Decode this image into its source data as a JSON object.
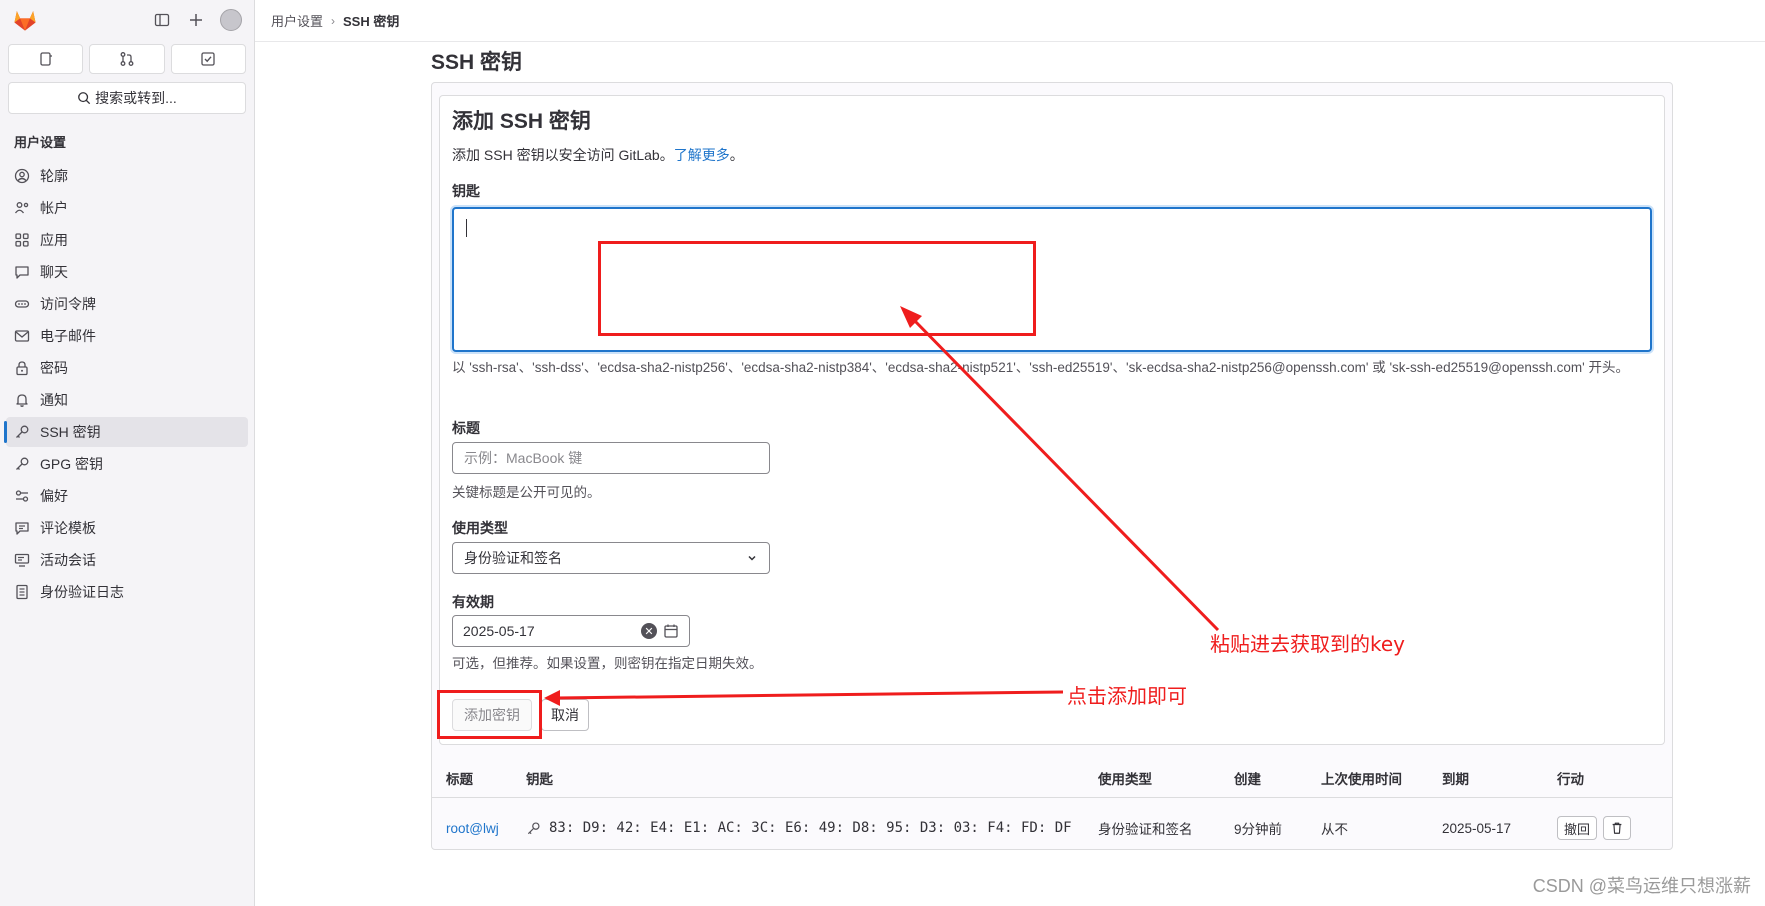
{
  "sidebar": {
    "search_label": "搜索或转到...",
    "section_title": "用户设置",
    "items": [
      {
        "label": "轮廓",
        "icon": "profile-icon"
      },
      {
        "label": "帐户",
        "icon": "account-icon"
      },
      {
        "label": "应用",
        "icon": "applications-icon"
      },
      {
        "label": "聊天",
        "icon": "chat-icon"
      },
      {
        "label": "访问令牌",
        "icon": "token-icon"
      },
      {
        "label": "电子邮件",
        "icon": "mail-icon"
      },
      {
        "label": "密码",
        "icon": "lock-icon"
      },
      {
        "label": "通知",
        "icon": "bell-icon"
      },
      {
        "label": "SSH 密钥",
        "icon": "key-icon",
        "active": true
      },
      {
        "label": "GPG 密钥",
        "icon": "key-icon"
      },
      {
        "label": "偏好",
        "icon": "preferences-icon"
      },
      {
        "label": "评论模板",
        "icon": "comment-icon"
      },
      {
        "label": "活动会话",
        "icon": "monitor-icon"
      },
      {
        "label": "身份验证日志",
        "icon": "log-icon"
      }
    ]
  },
  "breadcrumb": {
    "parent": "用户设置",
    "current": "SSH 密钥"
  },
  "page": {
    "title": "SSH 密钥"
  },
  "form": {
    "heading": "添加 SSH 密钥",
    "description": "添加 SSH 密钥以安全访问 GitLab。",
    "learn_more": "了解更多",
    "description_end": "。",
    "key_label": "钥匙",
    "key_value": "",
    "key_help": "以 'ssh-rsa'、'ssh-dss'、'ecdsa-sha2-nistp256'、'ecdsa-sha2-nistp384'、'ecdsa-sha2-nistp521'、'ssh-ed25519'、'sk-ecdsa-sha2-nistp256@openssh.com' 或 'sk-ssh-ed25519@openssh.com' 开头。",
    "title_label": "标题",
    "title_placeholder": "示例：MacBook 键",
    "title_help": "关键标题是公开可见的。",
    "usage_label": "使用类型",
    "usage_value": "身份验证和签名",
    "expire_label": "有效期",
    "expire_value": "2025-05-17",
    "expire_help": "可选，但推荐。如果设置，则密钥在指定日期失效。",
    "add_button": "添加密钥",
    "cancel_button": "取消"
  },
  "table": {
    "headers": [
      "标题",
      "钥匙",
      "使用类型",
      "创建",
      "上次使用时间",
      "到期",
      "行动"
    ],
    "rows": [
      {
        "title": "root@lwj",
        "fingerprint": "83: D9: 42: E4: E1: AC: 3C: E6: 49: D8: 95: D3: 03: F4: FD: DF",
        "usage": "身份验证和签名",
        "created": "9分钟前",
        "last_used": "从不",
        "expires": "2025-05-17",
        "revoke": "撤回"
      }
    ]
  },
  "annotations": {
    "paste_hint": "粘贴进去获取到的key",
    "click_hint": "点击添加即可"
  },
  "watermark": "CSDN @菜鸟运维只想涨薪",
  "colors": {
    "accent": "#1f75cb",
    "annotation": "#ef1d1d"
  }
}
